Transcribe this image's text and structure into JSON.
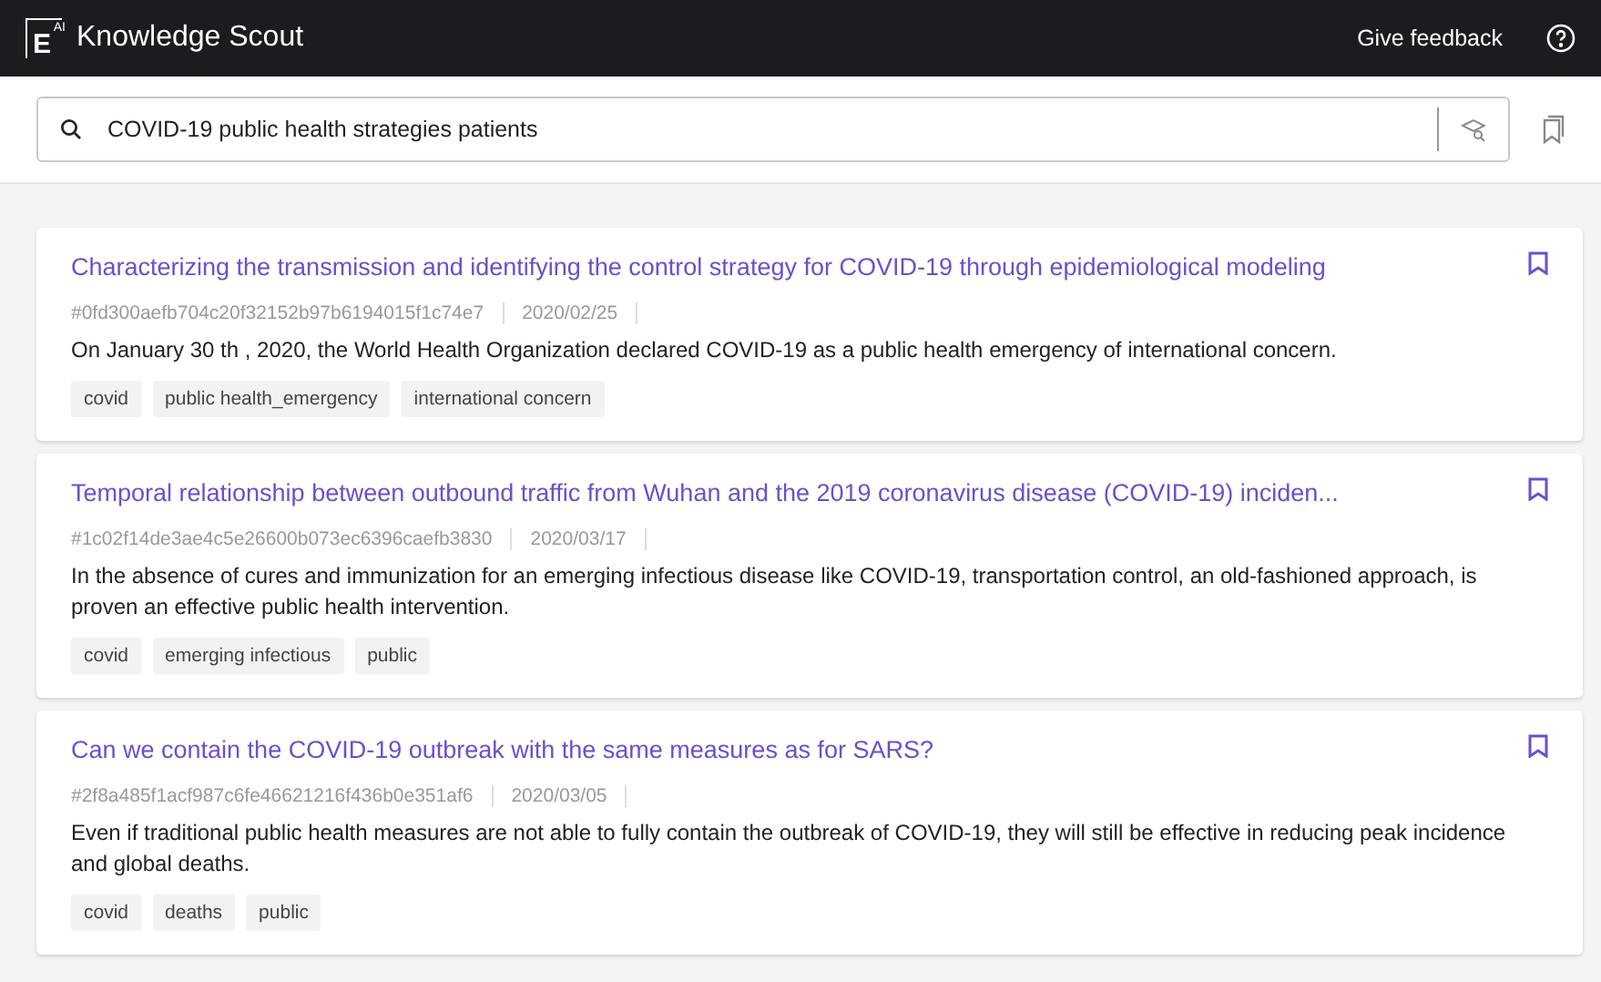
{
  "header": {
    "logo": {
      "letter": "E",
      "superscript": "AI"
    },
    "app_name": "Knowledge Scout",
    "feedback_link": "Give feedback"
  },
  "search": {
    "value": "COVID-19 public health strategies patients"
  },
  "results": [
    {
      "title": "Characterizing the transmission and identifying the control strategy for COVID-19 through epidemiological modeling",
      "id": "#0fd300aefb704c20f32152b97b6194015f1c74e7",
      "date": "2020/02/25",
      "summary": "On January 30 th , 2020, the World Health Organization declared COVID-19 as a public health emergency of international concern.",
      "tags": [
        "covid",
        "public health_emergency",
        "international concern"
      ]
    },
    {
      "title": "Temporal relationship between outbound traffic from Wuhan and the 2019 coronavirus disease (COVID-19) inciden...",
      "id": "#1c02f14de3ae4c5e26600b073ec6396caefb3830",
      "date": "2020/03/17",
      "summary": "In the absence of cures and immunization for an emerging infectious disease like COVID-19, transportation control, an old-fashioned approach, is proven an effective public health intervention.",
      "tags": [
        "covid",
        "emerging infectious",
        "public"
      ]
    },
    {
      "title": "Can we contain the COVID-19 outbreak with the same measures as for SARS?",
      "id": "#2f8a485f1acf987c6fe46621216f436b0e351af6",
      "date": "2020/03/05",
      "summary": "Even if traditional public health measures are not able to fully contain the outbreak of COVID-19, they will still be effective in reducing peak incidence and global deaths.",
      "tags": [
        "covid",
        "deaths",
        "public"
      ]
    }
  ]
}
